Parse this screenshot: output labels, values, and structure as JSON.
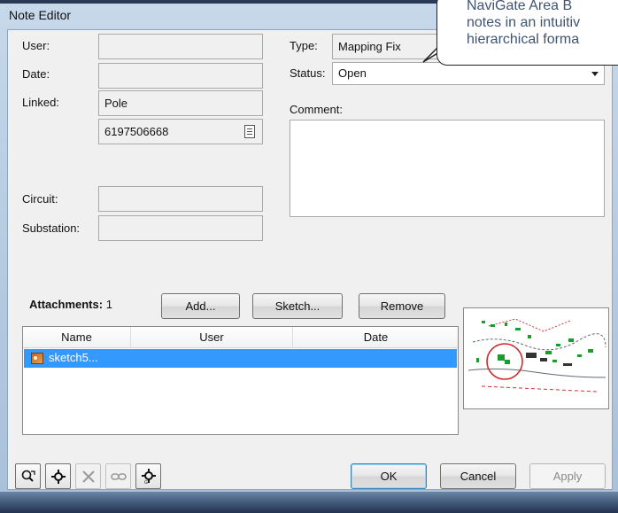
{
  "window": {
    "title": "Note Editor"
  },
  "fields": {
    "user": {
      "label": "User:",
      "value": ""
    },
    "date": {
      "label": "Date:",
      "value": ""
    },
    "linked": {
      "label": "Linked:",
      "value": "Pole",
      "id": "6197506668"
    },
    "circuit": {
      "label": "Circuit:",
      "value": ""
    },
    "substation": {
      "label": "Substation:",
      "value": ""
    },
    "type": {
      "label": "Type:",
      "value": "Mapping Fix"
    },
    "status": {
      "label": "Status:",
      "value": "Open"
    },
    "comment": {
      "label": "Comment:",
      "value": ""
    }
  },
  "attachments": {
    "label": "Attachments:",
    "count": "1",
    "buttons": {
      "add": "Add...",
      "sketch": "Sketch...",
      "remove": "Remove"
    },
    "columns": [
      "Name",
      "User",
      "Date"
    ],
    "rows": [
      {
        "name": "sketch5...",
        "user": "",
        "date": ""
      }
    ]
  },
  "footer": {
    "ok": "OK",
    "cancel": "Cancel",
    "apply": "Apply",
    "tools": [
      "zoom-to-note-icon",
      "locate-icon",
      "delete-icon",
      "link-icon",
      "go-to-location-icon"
    ]
  },
  "callout": {
    "lines": [
      "NaviGate Area B",
      "notes in an intuitiv",
      "hierarchical forma"
    ]
  }
}
